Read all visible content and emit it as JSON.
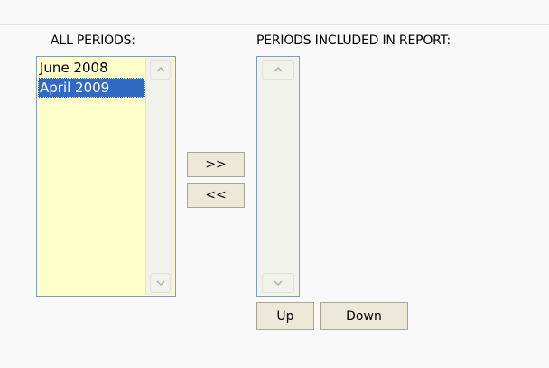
{
  "all_periods": {
    "label": "ALL PERIODS:",
    "options": [
      "June 2008",
      "April 2009"
    ],
    "selected": "April 2009"
  },
  "included_periods": {
    "label": "PERIODS INCLUDED IN REPORT:",
    "options": []
  },
  "buttons": {
    "add": ">>",
    "remove": "<<",
    "up": "Up",
    "down": "Down"
  },
  "icons": {
    "scroll_up": "chevron-up-icon",
    "scroll_down": "chevron-down-icon"
  },
  "colors": {
    "list_background": "#ffffcc",
    "selection": "#316ac5",
    "button_face": "#ece9d8",
    "list_border": "#7f9db9"
  }
}
